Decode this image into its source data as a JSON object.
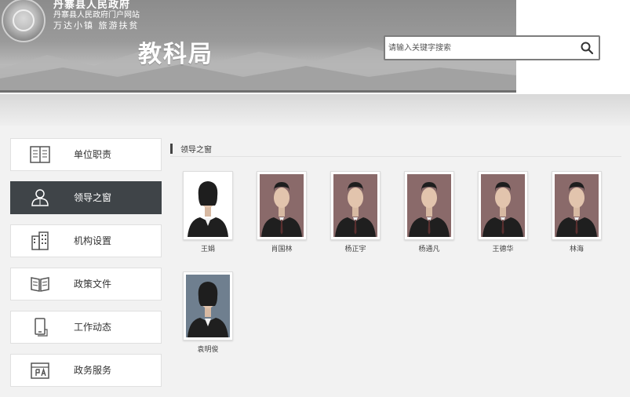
{
  "site": {
    "line1": "丹寨县人民政府",
    "line2": "丹寨县人民政府门户网站",
    "line3": "万达小镇 旅游扶贫"
  },
  "department": {
    "title": "教科局"
  },
  "search": {
    "placeholder": "请输入关键字搜索",
    "icon": "search-icon"
  },
  "sidebar": {
    "items": [
      {
        "label": "单位职责",
        "icon": "duties-icon",
        "active": false
      },
      {
        "label": "领导之窗",
        "icon": "leader-icon",
        "active": true
      },
      {
        "label": "机构设置",
        "icon": "building-icon",
        "active": false
      },
      {
        "label": "政策文件",
        "icon": "book-icon",
        "active": false
      },
      {
        "label": "工作动态",
        "icon": "phone-icon",
        "active": false
      },
      {
        "label": "政务服务",
        "icon": "service-icon",
        "active": false
      }
    ]
  },
  "main": {
    "section_title": "领导之窗",
    "leaders": [
      {
        "name": "王娟",
        "background": "white"
      },
      {
        "name": "肖国林",
        "background": "red"
      },
      {
        "name": "杨正宇",
        "background": "red"
      },
      {
        "name": "杨通凡",
        "background": "red"
      },
      {
        "name": "王德华",
        "background": "red"
      },
      {
        "name": "林海",
        "background": "red"
      },
      {
        "name": "袁明俊",
        "background": "blue"
      }
    ]
  },
  "colors": {
    "active_nav": "#3f4448",
    "header_band": "#9a9a9a",
    "photo_red": "#8a6a6a",
    "photo_blue": "#6f7f8f"
  }
}
